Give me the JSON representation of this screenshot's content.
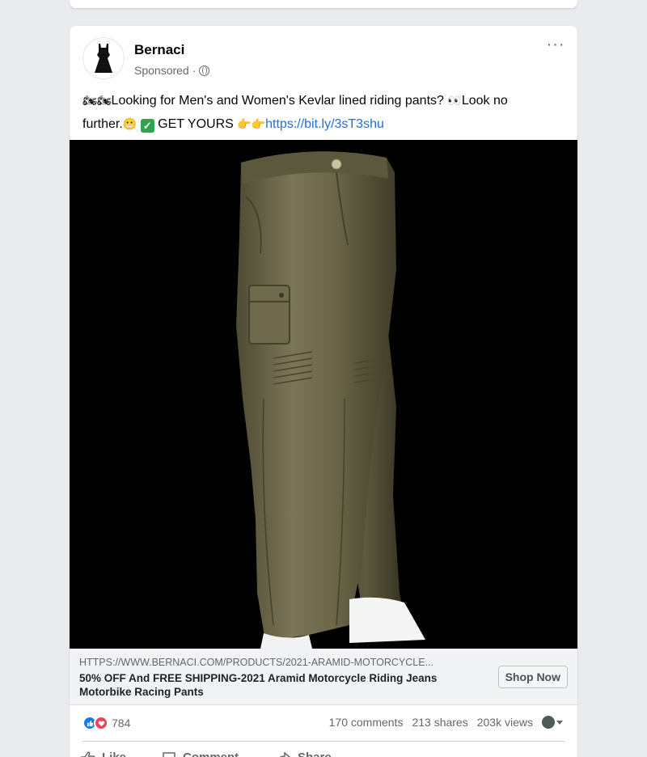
{
  "post": {
    "page_name": "Bernaci",
    "sponsored_label": "Sponsored",
    "separator": "·",
    "more_label": "···",
    "text_line1": "Looking for Men's and Women's Kevlar lined riding pants? ",
    "text_line1_end": "Look no",
    "text_line2_start": "further.",
    "cta_text": "GET YOURS",
    "link": "https://bit.ly/3sT3shu"
  },
  "link_preview": {
    "url": "HTTPS://WWW.BERNACI.COM/PRODUCTS/2021-ARAMID-MOTORCYCLE...",
    "title": "50% OFF And FREE SHIPPING-2021 Aramid Motorcycle Riding Jeans Motorbike Racing Pants",
    "button_label": "Shop Now"
  },
  "stats": {
    "reaction_count": "784",
    "comments": "170 comments",
    "shares": "213 shares",
    "views": "203k views"
  },
  "actions": {
    "like": "Like",
    "comment": "Comment",
    "share": "Share"
  },
  "colors": {
    "link": "#216fdb",
    "like_blue": "#1877f2",
    "love_red": "#f33e58",
    "pants_olive": "#6b6648"
  },
  "icons": [
    "globe-icon",
    "more-icon",
    "like-reaction-icon",
    "love-reaction-icon",
    "like-icon",
    "comment-icon",
    "share-icon"
  ]
}
